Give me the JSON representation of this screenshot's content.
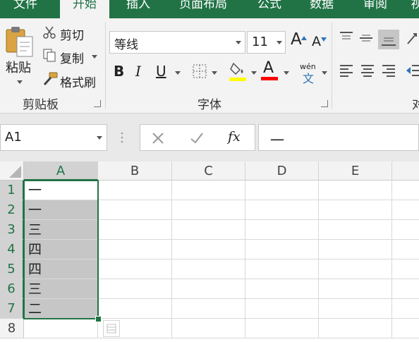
{
  "tabs": [
    "文件",
    "开始",
    "插入",
    "页面布局",
    "公式",
    "数据",
    "审阅",
    "视"
  ],
  "clipboard": {
    "paste_label": "粘贴",
    "cut_label": "剪切",
    "copy_label": "复制",
    "format_painter_label": "格式刷",
    "group_label": "剪贴板"
  },
  "font": {
    "name": "等线",
    "size": "11",
    "increase_label": "A",
    "decrease_label": "A",
    "bold": "B",
    "italic": "I",
    "underline": "U",
    "font_color_letter": "A",
    "fill_color": "#ffff00",
    "font_color": "#ff0000",
    "phonetic_top": "wén",
    "phonetic_bottom": "文",
    "group_label": "字体"
  },
  "alignment": {
    "group_label_partial": "对"
  },
  "formula_bar": {
    "name_box": "A1",
    "fx_label": "fx",
    "content": "一"
  },
  "sheet": {
    "columns": [
      "A",
      "B",
      "C",
      "D",
      "E"
    ],
    "rows": [
      "1",
      "2",
      "3",
      "4",
      "5",
      "6",
      "7",
      "8"
    ],
    "column_a_values": [
      "一",
      "一",
      "三",
      "四",
      "四",
      "三",
      "二",
      ""
    ],
    "selected_column": "A",
    "selected_rows": "1-7"
  },
  "colors": {
    "accent_green": "#217346",
    "selection_fill": "#c6c6c6"
  }
}
